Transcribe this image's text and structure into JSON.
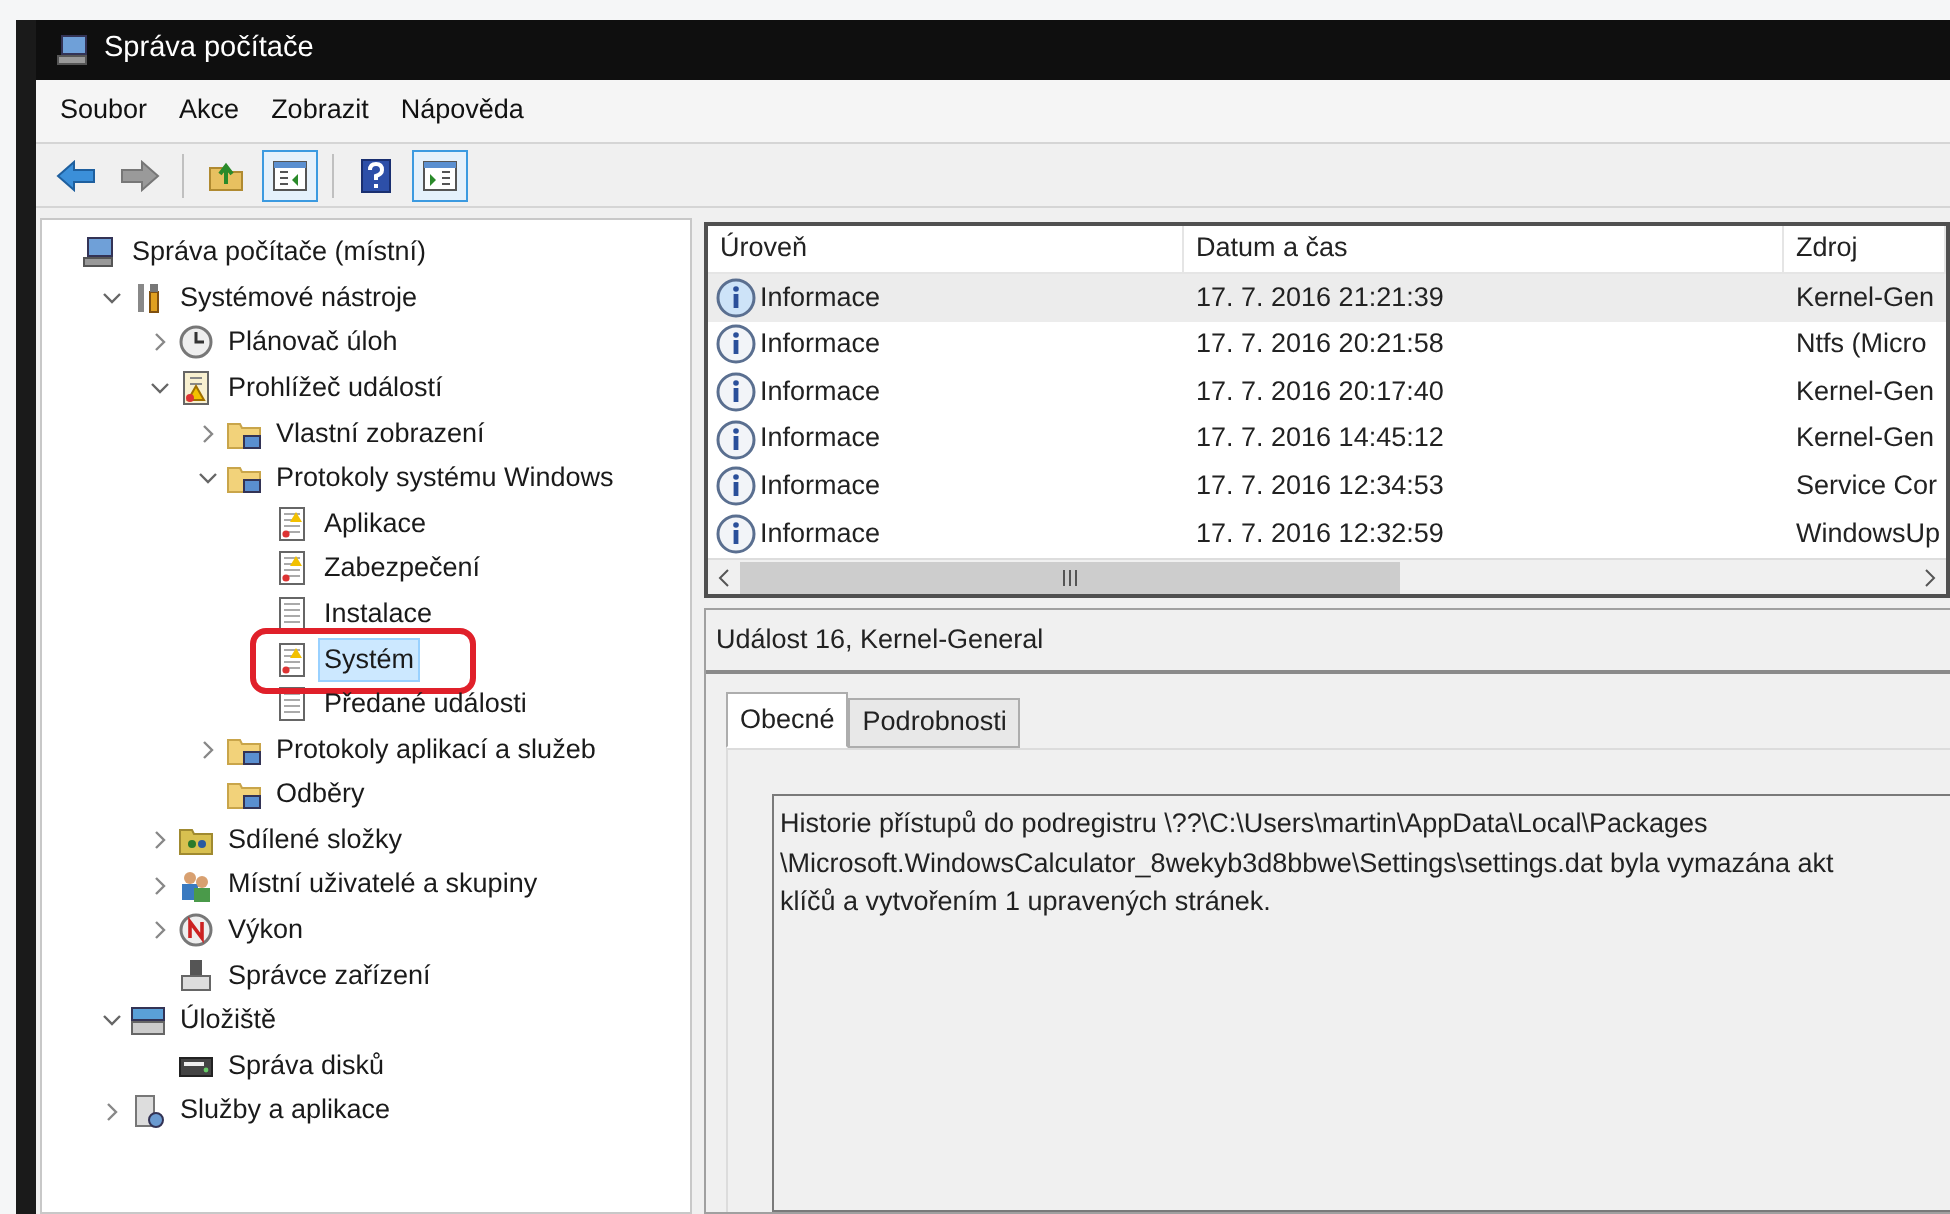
{
  "window": {
    "title": "Správa počítače"
  },
  "menu": [
    "Soubor",
    "Akce",
    "Zobrazit",
    "Nápověda"
  ],
  "toolbar": [
    {
      "kind": "back"
    },
    {
      "kind": "forward"
    },
    {
      "kind": "sep"
    },
    {
      "kind": "up"
    },
    {
      "kind": "tree-toggle"
    },
    {
      "kind": "sep"
    },
    {
      "kind": "help"
    },
    {
      "kind": "action-toggle"
    }
  ],
  "tree": [
    {
      "label": "Správa počítače (místní)",
      "kind": "computer",
      "selected": false,
      "children": [
        {
          "label": "Systémové nástroje",
          "kind": "tools",
          "expanded": true,
          "selected": false,
          "children": [
            {
              "label": "Plánovač úloh",
              "kind": "clock",
              "expanded": false,
              "selected": false
            },
            {
              "label": "Prohlížeč událostí",
              "kind": "eventlog",
              "expanded": true,
              "selected": false,
              "children": [
                {
                  "label": "Vlastní zobrazení",
                  "kind": "folder",
                  "expanded": false,
                  "selected": false
                },
                {
                  "label": "Protokoly systému Windows",
                  "kind": "folder",
                  "expanded": true,
                  "selected": false,
                  "children": [
                    {
                      "label": "Aplikace",
                      "kind": "log",
                      "selected": false
                    },
                    {
                      "label": "Zabezpečení",
                      "kind": "log",
                      "selected": false
                    },
                    {
                      "label": "Instalace",
                      "kind": "plainlog",
                      "selected": false
                    },
                    {
                      "label": "Systém",
                      "kind": "log",
                      "selected": true,
                      "circled": true
                    },
                    {
                      "label": "Předané události",
                      "kind": "plainlog",
                      "selected": false
                    }
                  ]
                },
                {
                  "label": "Protokoly aplikací a služeb",
                  "kind": "folder",
                  "expanded": false,
                  "selected": false
                },
                {
                  "label": "Odběry",
                  "kind": "folder",
                  "selected": false
                }
              ]
            },
            {
              "label": "Sdílené složky",
              "kind": "share",
              "expanded": false,
              "selected": false
            },
            {
              "label": "Místní uživatelé a skupiny",
              "kind": "users",
              "expanded": false,
              "selected": false
            },
            {
              "label": "Výkon",
              "kind": "perf",
              "expanded": false,
              "selected": false
            },
            {
              "label": "Správce zařízení",
              "kind": "device",
              "selected": false
            }
          ]
        },
        {
          "label": "Úložiště",
          "kind": "storage",
          "expanded": true,
          "selected": false,
          "children": [
            {
              "label": "Správa disků",
              "kind": "disk",
              "selected": false
            }
          ]
        },
        {
          "label": "Služby a aplikace",
          "kind": "services",
          "expanded": false,
          "selected": false
        }
      ]
    }
  ],
  "table": {
    "columns": [
      "Úroveň",
      "Datum a čas",
      "Zdroj"
    ],
    "rows": [
      {
        "level_text": "Informace",
        "date": "17. 7. 2016 21:21:39",
        "source": "Kernel-Gen",
        "selected": true
      },
      {
        "level_text": "Informace",
        "date": "17. 7. 2016 20:21:58",
        "source": "Ntfs (Micro",
        "selected": false
      },
      {
        "level_text": "Informace",
        "date": "17. 7. 2016 20:17:40",
        "source": "Kernel-Gen",
        "selected": false
      },
      {
        "level_text": "Informace",
        "date": "17. 7. 2016 14:45:12",
        "source": "Kernel-Gen",
        "selected": false
      },
      {
        "level_text": "Informace",
        "date": "17. 7. 2016 12:34:53",
        "source": "Service Cor",
        "selected": false
      },
      {
        "level_text": "Informace",
        "date": "17. 7. 2016 12:32:59",
        "source": "WindowsUp",
        "selected": false
      }
    ]
  },
  "details": {
    "title": "Událost 16, Kernel-General",
    "tabs": [
      {
        "label": "Obecné",
        "selected": true
      },
      {
        "label": "Podrobnosti",
        "selected": false
      }
    ],
    "message_lines": [
      "Historie přístupů do podregistru \\??\\C:\\Users\\martin\\AppData\\Local\\Packages",
      "\\Microsoft.WindowsCalculator_8wekyb3d8bbwe\\Settings\\settings.dat byla vymazána akt",
      "klíčů a vytvořením 1 upravených stránek."
    ]
  }
}
